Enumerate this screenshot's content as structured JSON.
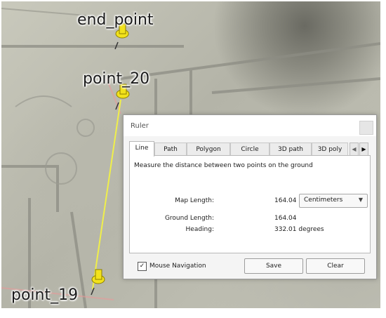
{
  "map": {
    "pins": [
      {
        "label": "end_point"
      },
      {
        "label": "point_20"
      },
      {
        "label": "point_19"
      }
    ],
    "line_color": "#f0ef4a",
    "pin_color": "#f2e21b"
  },
  "dialog": {
    "title": "Ruler",
    "tabs": [
      "Line",
      "Path",
      "Polygon",
      "Circle",
      "3D path",
      "3D poly"
    ],
    "active_tab": "Line",
    "tab_scroll_left": "◀",
    "tab_scroll_right": "▶",
    "description": "Measure the distance between two points on the ground",
    "map_length_label": "Map Length:",
    "map_length_value": "164.04",
    "unit_selected": "Centimeters",
    "unit_arrow": "▼",
    "ground_length_label": "Ground Length:",
    "ground_length_value": "164.04",
    "heading_label": "Heading:",
    "heading_value": "332.01 degrees",
    "mouse_nav_checked": "✓",
    "mouse_nav_label": "Mouse Navigation",
    "save_label": "Save",
    "clear_label": "Clear"
  }
}
